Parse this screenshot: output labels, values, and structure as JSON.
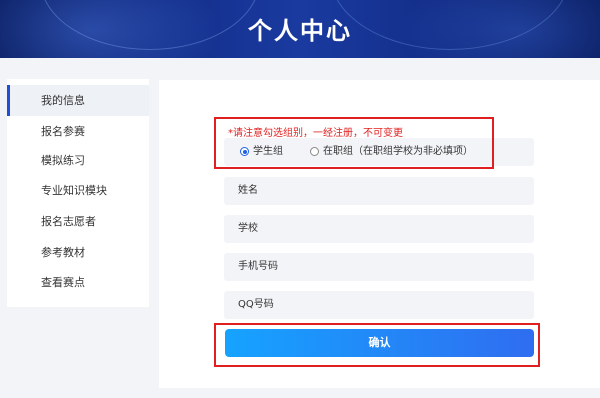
{
  "header": {
    "title": "个人中心"
  },
  "sidebar": {
    "items": [
      {
        "label": "我的信息",
        "active": true
      },
      {
        "label": "报名参赛"
      },
      {
        "label": "模拟练习"
      },
      {
        "label": "专业知识模块"
      },
      {
        "label": "报名志愿者"
      },
      {
        "label": "参考教材"
      },
      {
        "label": "查看赛点"
      }
    ]
  },
  "form": {
    "notice": "*请注意勾选组别，一经注册，不可变更",
    "group_options": [
      {
        "label": "学生组",
        "selected": true
      },
      {
        "label": "在职组（在职组学校为非必填项）",
        "selected": false
      }
    ],
    "fields": {
      "name_placeholder": "姓名",
      "school_placeholder": "学校",
      "phone_placeholder": "手机号码",
      "qq_placeholder": "QQ号码"
    },
    "submit_label": "确认"
  },
  "colors": {
    "accent": "#1e4fd6",
    "highlight_border": "#e02020",
    "notice_text": "#e02020",
    "button_gradient_start": "#16a3ff",
    "button_gradient_end": "#2f6df0"
  }
}
